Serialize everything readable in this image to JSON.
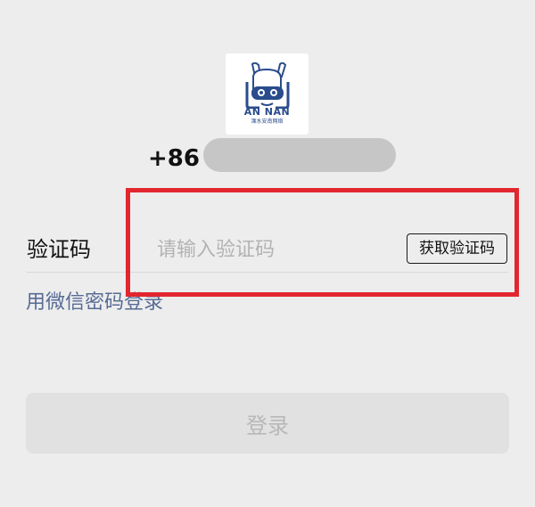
{
  "logo": {
    "wordmark": "AN NAN",
    "tagline": "溧水安南网络",
    "icon": "rabbit-mascot-icon",
    "color": "#2a4c8c"
  },
  "phone": {
    "country_code": "+86",
    "masked": true
  },
  "verification": {
    "label": "验证码",
    "placeholder": "请输入验证码",
    "value": "",
    "get_code_label": "获取验证码"
  },
  "alt_login": {
    "label": "用微信密码登录"
  },
  "login": {
    "label": "登录",
    "enabled": false
  },
  "colors": {
    "background": "#ededed",
    "link": "#576b95",
    "highlight": "#e22630",
    "button_disabled_bg": "#e1e1e1",
    "button_disabled_text": "#b8b8b8"
  }
}
